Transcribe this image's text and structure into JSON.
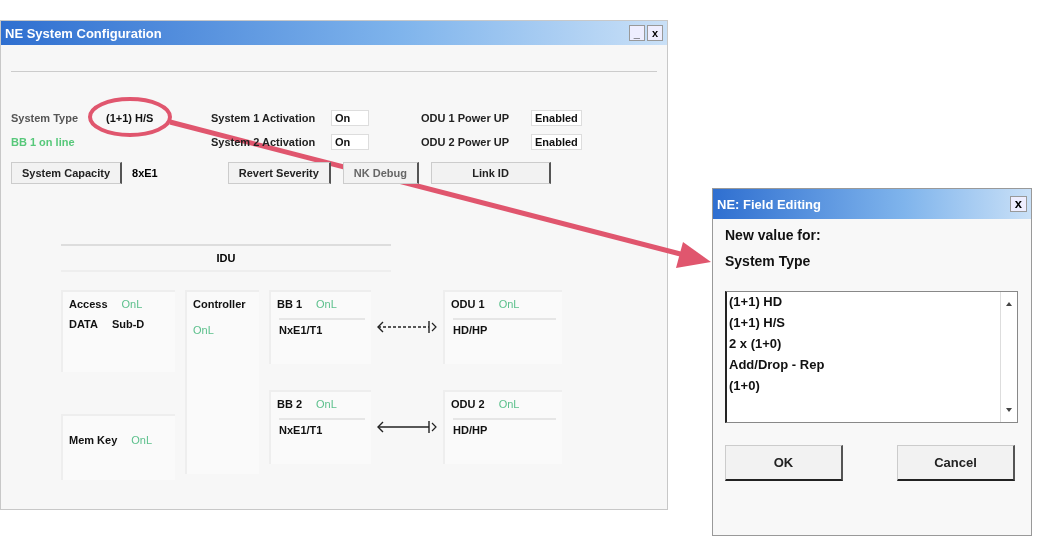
{
  "main_window": {
    "title": "NE System Configuration",
    "controls": [
      "_",
      "x"
    ],
    "fields": [
      {
        "label": "System Type",
        "value": "(1+1) H/S"
      },
      {
        "label": "System 1 Activation",
        "value": "On"
      },
      {
        "label": "ODU 1 Power UP",
        "value": "Enabled"
      },
      {
        "label": "System 2 Activation",
        "value": "On"
      },
      {
        "label": "ODU 2 Power UP",
        "value": "Enabled"
      }
    ],
    "status": "BB 1 on line",
    "capacity": {
      "button": "System Capacity",
      "value": "8xE1"
    },
    "buttons": [
      "Revert Severity",
      "NK Debug",
      "Link ID"
    ],
    "idu": {
      "title": "IDU",
      "access": {
        "name": "Access",
        "state": "OnL",
        "values": [
          "DATA",
          "Sub-D"
        ]
      },
      "controller": {
        "name": "Controller",
        "state": "OnL"
      },
      "mem_key": {
        "name": "Mem Key",
        "state": "OnL"
      },
      "links": [
        {
          "bb": {
            "name": "BB 1",
            "state": "OnL",
            "value": "NxE1/T1"
          },
          "odu": {
            "name": "ODU 1",
            "state": "OnL",
            "value": "HD/HP"
          },
          "dashed": true
        },
        {
          "bb": {
            "name": "BB 2",
            "state": "OnL",
            "value": "NxE1/T1"
          },
          "odu": {
            "name": "ODU 2",
            "state": "OnL",
            "value": "HD/HP"
          },
          "dashed": false
        }
      ]
    }
  },
  "dialog": {
    "title": "NE: Field Editing",
    "close": "x",
    "prompt": "New value for:",
    "field": "System Type",
    "options": [
      "(1+1) HD",
      "(1+1) H/S",
      "2 x (1+0)",
      "Add/Drop - Rep",
      "(1+0)"
    ],
    "buttons": [
      "OK",
      "Cancel"
    ]
  }
}
